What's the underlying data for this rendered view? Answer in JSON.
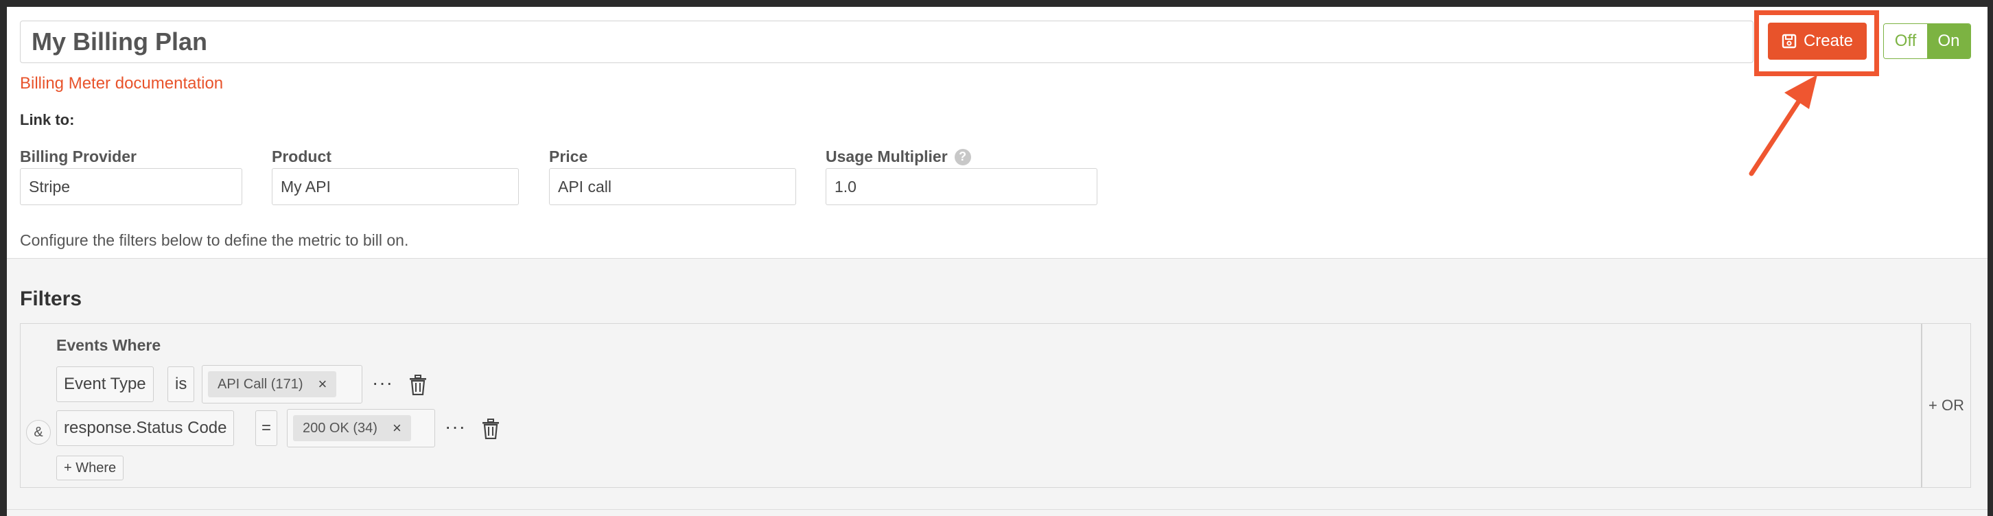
{
  "header": {
    "plan_name": "My Billing Plan",
    "doc_link": "Billing Meter documentation",
    "create_label": "Create",
    "toggle_off": "Off",
    "toggle_on": "On"
  },
  "link_to": {
    "label": "Link to:",
    "fields": [
      {
        "label": "Billing Provider",
        "value": "Stripe"
      },
      {
        "label": "Product",
        "value": "My API"
      },
      {
        "label": "Price",
        "value": "API call"
      },
      {
        "label": "Usage Multiplier",
        "value": "1.0",
        "help": "?"
      }
    ]
  },
  "config_note": "Configure the filters below to define the metric to bill on.",
  "filters": {
    "title": "Filters",
    "group_label": "Events Where",
    "conditions": [
      {
        "field": "Event Type",
        "operator": "is",
        "value_tag": "API Call (171)",
        "remove": "×",
        "more": "···"
      },
      {
        "connector": "&",
        "field": "response.Status Code",
        "operator": "=",
        "value_tag": "200 OK (34)",
        "remove": "×",
        "more": "···"
      }
    ],
    "add_where": "+ Where",
    "add_or": "+ OR"
  },
  "colors": {
    "accent": "#e8532b",
    "toggle_green": "#7cb342",
    "highlight": "#ef5630"
  }
}
